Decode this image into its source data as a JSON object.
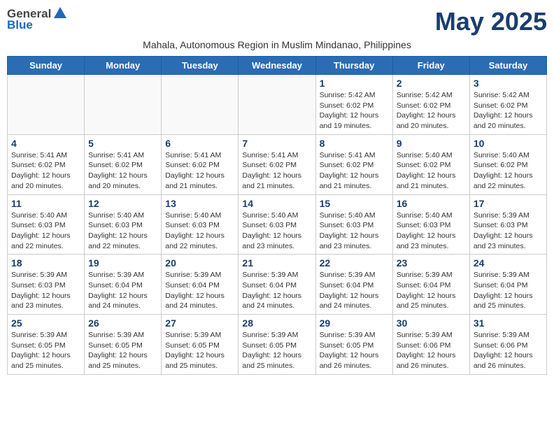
{
  "header": {
    "logo_general": "General",
    "logo_blue": "Blue",
    "month_title": "May 2025",
    "subtitle": "Mahala, Autonomous Region in Muslim Mindanao, Philippines"
  },
  "days_of_week": [
    "Sunday",
    "Monday",
    "Tuesday",
    "Wednesday",
    "Thursday",
    "Friday",
    "Saturday"
  ],
  "weeks": [
    [
      {
        "day": "",
        "info": ""
      },
      {
        "day": "",
        "info": ""
      },
      {
        "day": "",
        "info": ""
      },
      {
        "day": "",
        "info": ""
      },
      {
        "day": "1",
        "info": "Sunrise: 5:42 AM\nSunset: 6:02 PM\nDaylight: 12 hours and 19 minutes."
      },
      {
        "day": "2",
        "info": "Sunrise: 5:42 AM\nSunset: 6:02 PM\nDaylight: 12 hours and 20 minutes."
      },
      {
        "day": "3",
        "info": "Sunrise: 5:42 AM\nSunset: 6:02 PM\nDaylight: 12 hours and 20 minutes."
      }
    ],
    [
      {
        "day": "4",
        "info": "Sunrise: 5:41 AM\nSunset: 6:02 PM\nDaylight: 12 hours and 20 minutes."
      },
      {
        "day": "5",
        "info": "Sunrise: 5:41 AM\nSunset: 6:02 PM\nDaylight: 12 hours and 20 minutes."
      },
      {
        "day": "6",
        "info": "Sunrise: 5:41 AM\nSunset: 6:02 PM\nDaylight: 12 hours and 21 minutes."
      },
      {
        "day": "7",
        "info": "Sunrise: 5:41 AM\nSunset: 6:02 PM\nDaylight: 12 hours and 21 minutes."
      },
      {
        "day": "8",
        "info": "Sunrise: 5:41 AM\nSunset: 6:02 PM\nDaylight: 12 hours and 21 minutes."
      },
      {
        "day": "9",
        "info": "Sunrise: 5:40 AM\nSunset: 6:02 PM\nDaylight: 12 hours and 21 minutes."
      },
      {
        "day": "10",
        "info": "Sunrise: 5:40 AM\nSunset: 6:02 PM\nDaylight: 12 hours and 22 minutes."
      }
    ],
    [
      {
        "day": "11",
        "info": "Sunrise: 5:40 AM\nSunset: 6:03 PM\nDaylight: 12 hours and 22 minutes."
      },
      {
        "day": "12",
        "info": "Sunrise: 5:40 AM\nSunset: 6:03 PM\nDaylight: 12 hours and 22 minutes."
      },
      {
        "day": "13",
        "info": "Sunrise: 5:40 AM\nSunset: 6:03 PM\nDaylight: 12 hours and 22 minutes."
      },
      {
        "day": "14",
        "info": "Sunrise: 5:40 AM\nSunset: 6:03 PM\nDaylight: 12 hours and 23 minutes."
      },
      {
        "day": "15",
        "info": "Sunrise: 5:40 AM\nSunset: 6:03 PM\nDaylight: 12 hours and 23 minutes."
      },
      {
        "day": "16",
        "info": "Sunrise: 5:40 AM\nSunset: 6:03 PM\nDaylight: 12 hours and 23 minutes."
      },
      {
        "day": "17",
        "info": "Sunrise: 5:39 AM\nSunset: 6:03 PM\nDaylight: 12 hours and 23 minutes."
      }
    ],
    [
      {
        "day": "18",
        "info": "Sunrise: 5:39 AM\nSunset: 6:03 PM\nDaylight: 12 hours and 23 minutes."
      },
      {
        "day": "19",
        "info": "Sunrise: 5:39 AM\nSunset: 6:04 PM\nDaylight: 12 hours and 24 minutes."
      },
      {
        "day": "20",
        "info": "Sunrise: 5:39 AM\nSunset: 6:04 PM\nDaylight: 12 hours and 24 minutes."
      },
      {
        "day": "21",
        "info": "Sunrise: 5:39 AM\nSunset: 6:04 PM\nDaylight: 12 hours and 24 minutes."
      },
      {
        "day": "22",
        "info": "Sunrise: 5:39 AM\nSunset: 6:04 PM\nDaylight: 12 hours and 24 minutes."
      },
      {
        "day": "23",
        "info": "Sunrise: 5:39 AM\nSunset: 6:04 PM\nDaylight: 12 hours and 25 minutes."
      },
      {
        "day": "24",
        "info": "Sunrise: 5:39 AM\nSunset: 6:04 PM\nDaylight: 12 hours and 25 minutes."
      }
    ],
    [
      {
        "day": "25",
        "info": "Sunrise: 5:39 AM\nSunset: 6:05 PM\nDaylight: 12 hours and 25 minutes."
      },
      {
        "day": "26",
        "info": "Sunrise: 5:39 AM\nSunset: 6:05 PM\nDaylight: 12 hours and 25 minutes."
      },
      {
        "day": "27",
        "info": "Sunrise: 5:39 AM\nSunset: 6:05 PM\nDaylight: 12 hours and 25 minutes."
      },
      {
        "day": "28",
        "info": "Sunrise: 5:39 AM\nSunset: 6:05 PM\nDaylight: 12 hours and 25 minutes."
      },
      {
        "day": "29",
        "info": "Sunrise: 5:39 AM\nSunset: 6:05 PM\nDaylight: 12 hours and 26 minutes."
      },
      {
        "day": "30",
        "info": "Sunrise: 5:39 AM\nSunset: 6:06 PM\nDaylight: 12 hours and 26 minutes."
      },
      {
        "day": "31",
        "info": "Sunrise: 5:39 AM\nSunset: 6:06 PM\nDaylight: 12 hours and 26 minutes."
      }
    ]
  ]
}
